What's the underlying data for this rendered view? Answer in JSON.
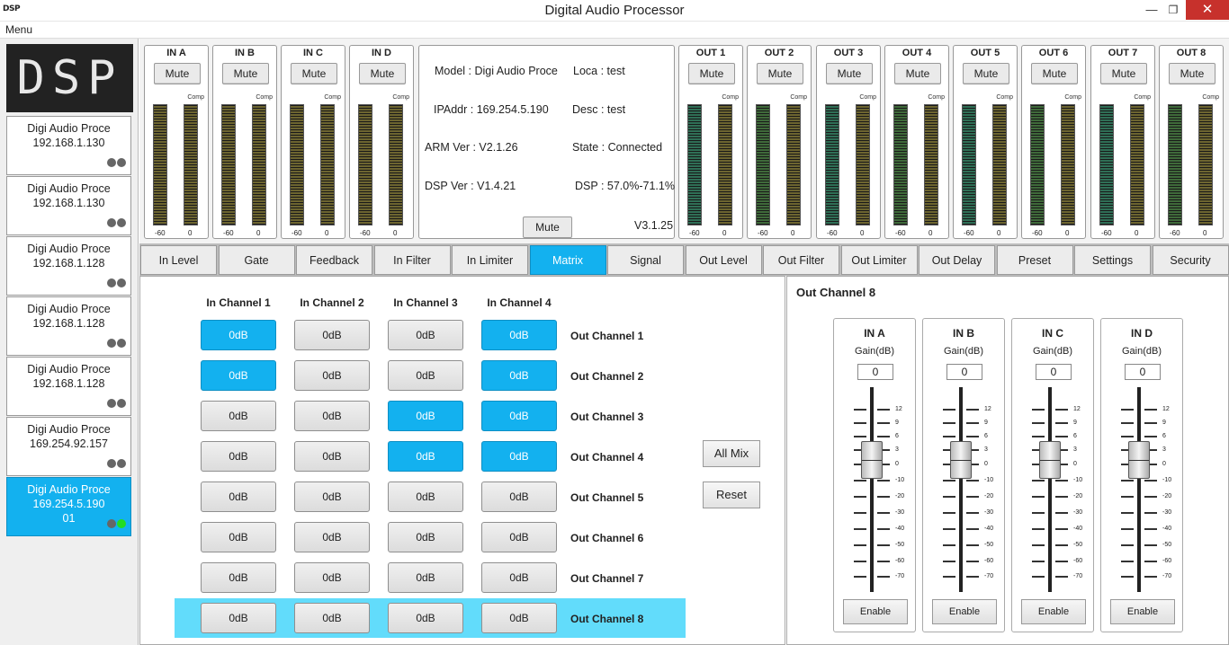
{
  "window": {
    "icon_text": "DSP",
    "title": "Digital Audio Processor",
    "minimize_glyph": "—",
    "maximize_glyph": "❐",
    "close_glyph": "✕"
  },
  "menu": {
    "label": "Menu"
  },
  "left_panel": {
    "logo": "DSP",
    "devices": [
      {
        "name": "Digi Audio Proce",
        "ip": "192.168.1.130",
        "extra": "",
        "active": false
      },
      {
        "name": "Digi Audio Proce",
        "ip": "192.168.1.130",
        "extra": "",
        "active": false
      },
      {
        "name": "Digi Audio Proce",
        "ip": "192.168.1.128",
        "extra": "",
        "active": false
      },
      {
        "name": "Digi Audio Proce",
        "ip": "192.168.1.128",
        "extra": "",
        "active": false
      },
      {
        "name": "Digi Audio Proce",
        "ip": "192.168.1.128",
        "extra": "",
        "active": false
      },
      {
        "name": "Digi Audio Proce",
        "ip": "169.254.92.157",
        "extra": "",
        "active": false
      },
      {
        "name": "Digi Audio Proce",
        "ip": "169.254.5.190",
        "extra": "01",
        "active": true
      }
    ]
  },
  "meters": {
    "comp_label": "Comp",
    "min_label": "-60",
    "max_label": "0",
    "inputs": [
      {
        "name": "IN A",
        "mute": "Mute"
      },
      {
        "name": "IN B",
        "mute": "Mute"
      },
      {
        "name": "IN C",
        "mute": "Mute"
      },
      {
        "name": "IN D",
        "mute": "Mute"
      }
    ],
    "outputs": [
      {
        "name": "OUT 1",
        "mute": "Mute"
      },
      {
        "name": "OUT 2",
        "mute": "Mute"
      },
      {
        "name": "OUT 3",
        "mute": "Mute"
      },
      {
        "name": "OUT 4",
        "mute": "Mute"
      },
      {
        "name": "OUT 5",
        "mute": "Mute"
      },
      {
        "name": "OUT 6",
        "mute": "Mute"
      },
      {
        "name": "OUT 7",
        "mute": "Mute"
      },
      {
        "name": "OUT 8",
        "mute": "Mute"
      }
    ],
    "colors": {
      "input_bar": "#6d6530",
      "output_bar": "#3f6a3a",
      "output_bar_alt": "#2f6f56"
    }
  },
  "info": {
    "model": "Model : Digi Audio Proce",
    "loca": "Loca : test",
    "ipaddr": "IPAddr : 169.254.5.190",
    "desc": "Desc : test",
    "arm_ver": "ARM Ver : V2.1.26",
    "state": "State : Connected",
    "dsp_ver": "DSP Ver : V1.4.21",
    "dsp_load": "DSP : 57.0%-71.1%",
    "mute": "Mute",
    "version": "V3.1.25"
  },
  "tabs": [
    {
      "label": "In Level",
      "active": false
    },
    {
      "label": "Gate",
      "active": false
    },
    {
      "label": "Feedback",
      "active": false
    },
    {
      "label": "In Filter",
      "active": false
    },
    {
      "label": "In Limiter",
      "active": false
    },
    {
      "label": "Matrix",
      "active": true
    },
    {
      "label": "Signal",
      "active": false
    },
    {
      "label": "Out Level",
      "active": false
    },
    {
      "label": "Out Filter",
      "active": false
    },
    {
      "label": "Out Limiter",
      "active": false
    },
    {
      "label": "Out Delay",
      "active": false
    },
    {
      "label": "Preset",
      "active": false
    },
    {
      "label": "Settings",
      "active": false
    },
    {
      "label": "Security",
      "active": false
    }
  ],
  "matrix": {
    "columns": [
      "In Channel 1",
      "In Channel 2",
      "In Channel 3",
      "In Channel 4"
    ],
    "rows": [
      {
        "label": "Out Channel 1",
        "cells": [
          "0dB",
          "0dB",
          "0dB",
          "0dB"
        ],
        "on": [
          true,
          false,
          false,
          true
        ]
      },
      {
        "label": "Out Channel 2",
        "cells": [
          "0dB",
          "0dB",
          "0dB",
          "0dB"
        ],
        "on": [
          true,
          false,
          false,
          true
        ]
      },
      {
        "label": "Out Channel 3",
        "cells": [
          "0dB",
          "0dB",
          "0dB",
          "0dB"
        ],
        "on": [
          false,
          false,
          true,
          true
        ]
      },
      {
        "label": "Out Channel 4",
        "cells": [
          "0dB",
          "0dB",
          "0dB",
          "0dB"
        ],
        "on": [
          false,
          false,
          true,
          true
        ]
      },
      {
        "label": "Out Channel 5",
        "cells": [
          "0dB",
          "0dB",
          "0dB",
          "0dB"
        ],
        "on": [
          false,
          false,
          false,
          false
        ]
      },
      {
        "label": "Out Channel 6",
        "cells": [
          "0dB",
          "0dB",
          "0dB",
          "0dB"
        ],
        "on": [
          false,
          false,
          false,
          false
        ]
      },
      {
        "label": "Out Channel 7",
        "cells": [
          "0dB",
          "0dB",
          "0dB",
          "0dB"
        ],
        "on": [
          false,
          false,
          false,
          false
        ]
      },
      {
        "label": "Out Channel 8",
        "cells": [
          "0dB",
          "0dB",
          "0dB",
          "0dB"
        ],
        "on": [
          false,
          false,
          false,
          false
        ]
      }
    ],
    "selected_row": 7,
    "all_mix": "All Mix",
    "reset": "Reset",
    "accent": "#13b1ef",
    "highlight": "#62dcfb"
  },
  "out_panel": {
    "title": "Out Channel 8",
    "gain_label": "Gain(dB)",
    "enable_label": "Enable",
    "scale": [
      "12",
      "9",
      "6",
      "3",
      "0",
      "-10",
      "-20",
      "-30",
      "-40",
      "-50",
      "-60",
      "-70"
    ],
    "strips": [
      {
        "name": "IN A",
        "gain": "0"
      },
      {
        "name": "IN B",
        "gain": "0"
      },
      {
        "name": "IN C",
        "gain": "0"
      },
      {
        "name": "IN D",
        "gain": "0"
      }
    ]
  }
}
